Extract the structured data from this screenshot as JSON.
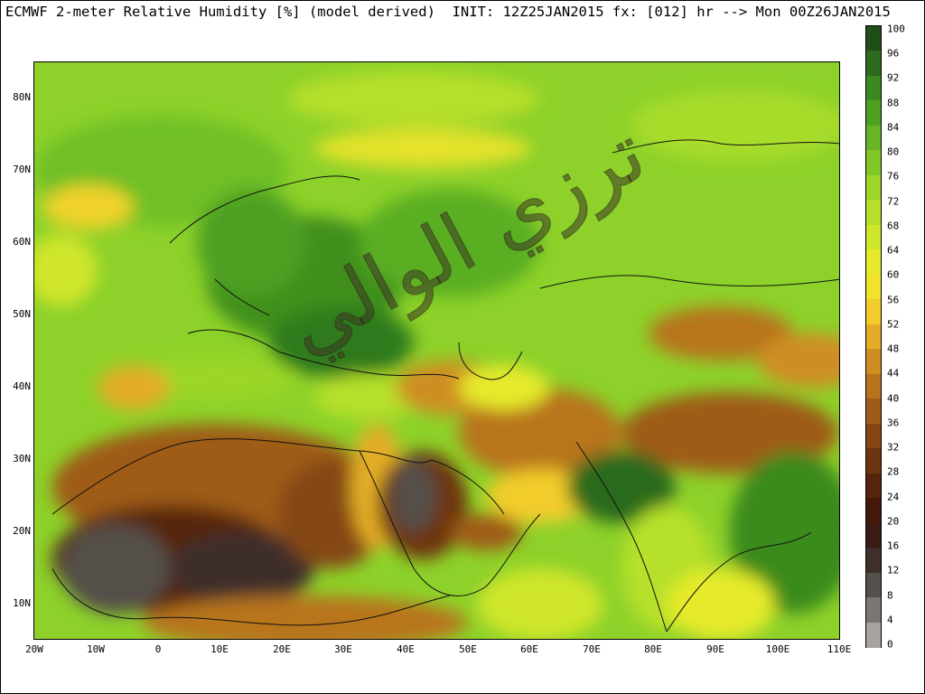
{
  "title": "ECMWF 2-meter Relative Humidity [%] (model derived)  INIT: 12Z25JAN2015 fx: [012] hr --> Mon 00Z26JAN2015",
  "lat_labels": [
    "80N",
    "70N",
    "60N",
    "50N",
    "40N",
    "30N",
    "20N",
    "10N"
  ],
  "lon_labels": [
    "20W",
    "10W",
    "0",
    "10E",
    "20E",
    "30E",
    "40E",
    "50E",
    "60E",
    "70E",
    "80E",
    "90E",
    "100E",
    "110E"
  ],
  "colorbar": {
    "labels": [
      "100",
      "96",
      "92",
      "88",
      "84",
      "80",
      "76",
      "72",
      "68",
      "64",
      "60",
      "56",
      "52",
      "48",
      "44",
      "40",
      "36",
      "32",
      "28",
      "24",
      "20",
      "16",
      "12",
      "8",
      "4",
      "0"
    ],
    "colors": [
      "#1f4f16",
      "#2c6a1c",
      "#3a8a1f",
      "#4ea021",
      "#67b525",
      "#80c727",
      "#9bd628",
      "#b6e02a",
      "#cfe62b",
      "#e6ea2c",
      "#f3e22c",
      "#f2cc2a",
      "#e3ad27",
      "#cf8e22",
      "#b8741d",
      "#9f5c18",
      "#854614",
      "#6d3410",
      "#57250d",
      "#44180b",
      "#3a1a12",
      "#3e2f2b",
      "#555049",
      "#7a7671",
      "#a6a3a0",
      "#d2d0ce"
    ]
  },
  "watermark_text": "ترزي الوالي"
}
